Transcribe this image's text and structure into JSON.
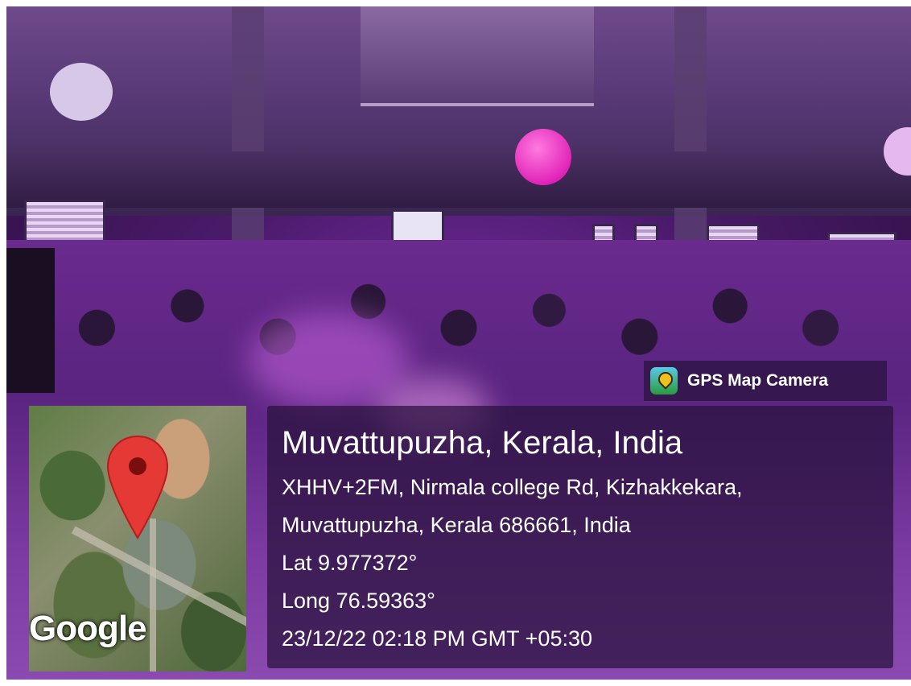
{
  "brand": {
    "label": "GPS Map Camera",
    "icon": "gps-map-camera-icon"
  },
  "map": {
    "attribution": "Google",
    "icon": "location-pin-icon",
    "pin_color": "#e53935"
  },
  "location": {
    "title": "Muvattupuzha, Kerala, India",
    "address_line1": "XHHV+2FM, Nirmala college Rd, Kizhakkekara,",
    "address_line2": "Muvattupuzha, Kerala 686661, India",
    "latitude": "Lat 9.977372°",
    "longitude": "Long 76.59363°",
    "timestamp": "23/12/22 02:18 PM GMT +05:30"
  },
  "colors": {
    "overlay": "#28123c",
    "scene_tint": "#7a2ea8"
  }
}
